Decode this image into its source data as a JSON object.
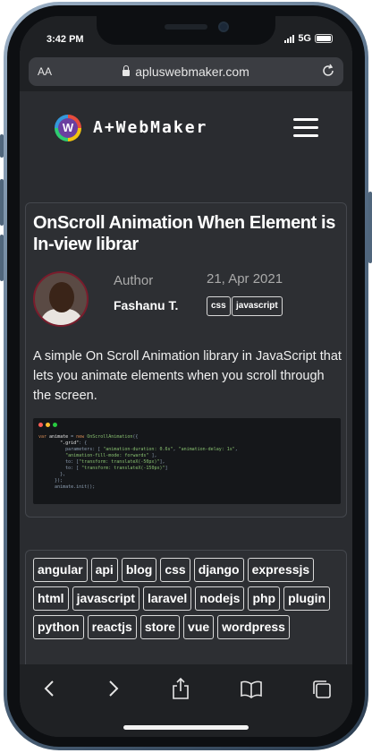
{
  "status": {
    "time": "3:42 PM",
    "network": "5G"
  },
  "browser": {
    "text_size_label": "AA",
    "url": "apluswebmaker.com"
  },
  "site": {
    "logo_letter": "W",
    "logo_text": "A+WebMaker"
  },
  "post": {
    "title": "OnScroll Animation When Element is In-view librar",
    "author_label": "Author",
    "author_name": "Fashanu T.",
    "date": "21, Apr 2021",
    "tags": [
      "css",
      "javascript"
    ],
    "excerpt": "A simple On Scroll Animation library in JavaScript that lets you animate elements when you scroll through the screen."
  },
  "tag_cloud": [
    "angular",
    "api",
    "blog",
    "css",
    "django",
    "expressjs",
    "html",
    "javascript",
    "laravel",
    "nodejs",
    "php",
    "plugin",
    "python",
    "reactjs",
    "store",
    "vue",
    "wordpress"
  ],
  "colors": {
    "page_bg": "#2a2c30",
    "card_bg": "#2d2f33",
    "border": "#44474d",
    "avatar_ring": "#7a1c2c"
  },
  "icons": [
    "lock-icon",
    "reload-icon",
    "hamburger-menu-icon",
    "back-icon",
    "forward-icon",
    "share-icon",
    "bookmarks-icon",
    "tabs-icon"
  ]
}
